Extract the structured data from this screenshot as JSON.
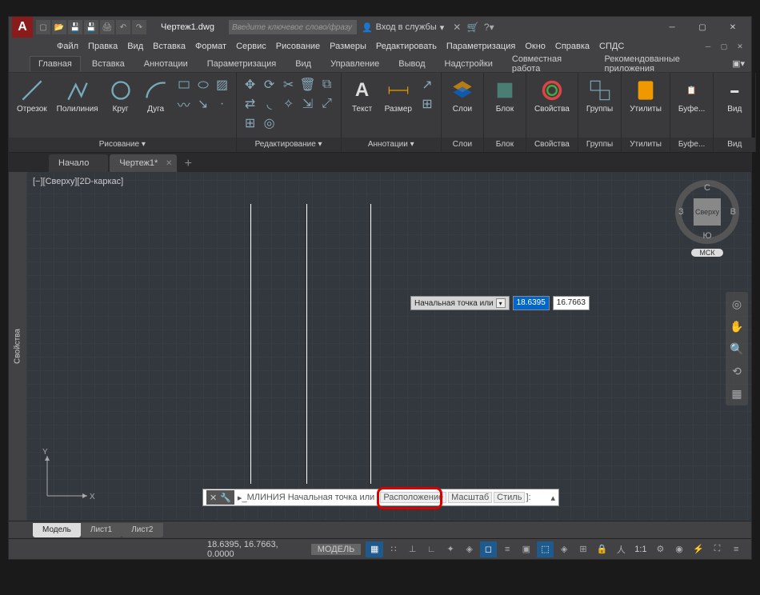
{
  "title": {
    "doc_name": "Чертеж1.dwg",
    "search_placeholder": "Введите ключевое слово/фразу",
    "login": "Вход в службы"
  },
  "menubar": {
    "items": [
      "Файл",
      "Правка",
      "Вид",
      "Вставка",
      "Формат",
      "Сервис",
      "Рисование",
      "Размеры",
      "Редактировать",
      "Параметризация",
      "Окно",
      "Справка",
      "СПДС"
    ]
  },
  "ribbon_tabs": {
    "items": [
      "Главная",
      "Вставка",
      "Аннотации",
      "Параметризация",
      "Вид",
      "Управление",
      "Вывод",
      "Надстройки",
      "Совместная работа",
      "Рекомендованные приложения"
    ],
    "active": 0
  },
  "ribbon": {
    "draw": {
      "label": "Рисование ▾",
      "line": "Отрезок",
      "pline": "Полилиния",
      "circle": "Круг",
      "arc": "Дуга"
    },
    "modify": {
      "label": "Редактирование ▾"
    },
    "annot": {
      "label": "Аннотации ▾",
      "text": "Текст",
      "dim": "Размер"
    },
    "layers": {
      "label": "Слои"
    },
    "block": {
      "label": "Блок"
    },
    "props": {
      "label": "Свойства"
    },
    "groups": {
      "label": "Группы"
    },
    "utils": {
      "label": "Утилиты"
    },
    "clip": {
      "label": "Буфе..."
    },
    "view": {
      "label": "Вид"
    }
  },
  "file_tabs": {
    "start": "Начало",
    "doc": "Чертеж1*"
  },
  "canvas": {
    "view_label": "[−][Сверху][2D-каркас]",
    "dyn": {
      "prompt": "Начальная точка или",
      "x": "18.6395",
      "y": "16.7663"
    },
    "viewcube": {
      "face": "Сверху",
      "n": "С",
      "s": "Ю",
      "e": "В",
      "w": "З",
      "wcs": "МСК"
    },
    "ucs": {
      "x": "X",
      "y": "Y"
    },
    "props_panel": "Свойства",
    "cmd": {
      "name": "МЛИНИЯ",
      "prompt": "Начальная точка или",
      "opt1": "Расположение",
      "opt2": "Масштаб",
      "opt3": "Стиль"
    }
  },
  "layout_tabs": {
    "model": "Модель",
    "l1": "Лист1",
    "l2": "Лист2"
  },
  "statusbar": {
    "coords": "18.6395, 16.7663, 0.0000",
    "model": "МОДЕЛЬ",
    "ratio": "1:1"
  }
}
